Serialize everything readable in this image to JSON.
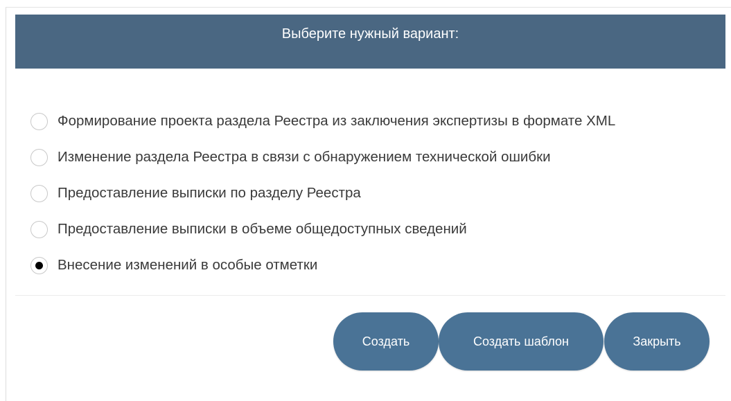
{
  "dialog": {
    "title": "Выберите нужный вариант:"
  },
  "options": [
    {
      "label": "Формирование проекта раздела Реестра из заключения экспертизы в формате XML",
      "selected": false
    },
    {
      "label": "Изменение раздела Реестра в связи с обнаружением технической ошибки",
      "selected": false
    },
    {
      "label": "Предоставление выписки по разделу Реестра",
      "selected": false
    },
    {
      "label": "Предоставление выписки в объеме общедоступных сведений",
      "selected": false
    },
    {
      "label": "Внесение изменений в особые отметки",
      "selected": true
    }
  ],
  "buttons": {
    "create": "Создать",
    "create_template": "Создать шаблон",
    "close": "Закрыть"
  },
  "colors": {
    "header": "#4a6782",
    "button": "#4a7396"
  }
}
